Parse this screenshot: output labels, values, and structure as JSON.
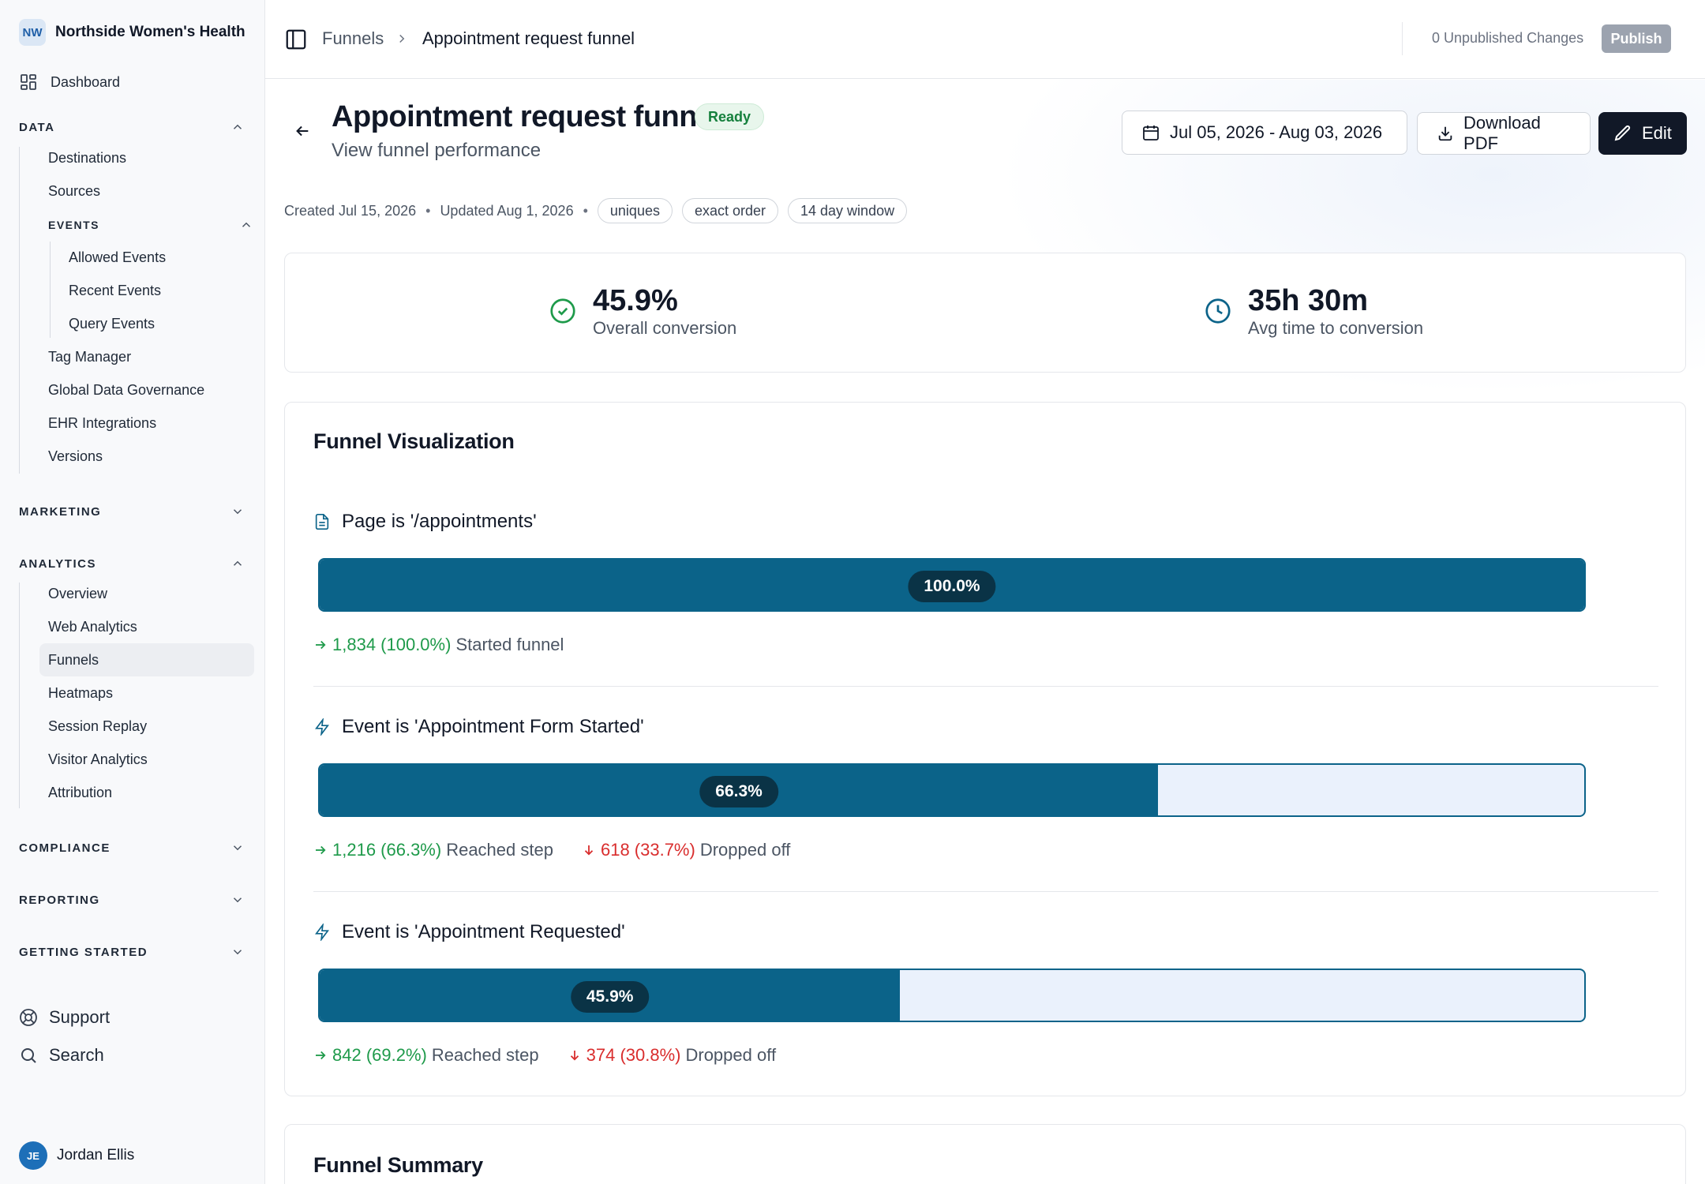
{
  "org": {
    "initials": "NW",
    "name": "Northside Women's Health"
  },
  "sidebar": {
    "dashboard": "Dashboard",
    "data": {
      "heading": "DATA",
      "items": [
        "Destinations",
        "Sources"
      ],
      "events": {
        "heading": "EVENTS",
        "items": [
          "Allowed Events",
          "Recent Events",
          "Query Events"
        ]
      },
      "more_items": [
        "Tag Manager",
        "Global Data Governance",
        "EHR Integrations",
        "Versions"
      ]
    },
    "marketing": "MARKETING",
    "analytics": {
      "heading": "ANALYTICS",
      "items": [
        "Overview",
        "Web Analytics",
        "Funnels",
        "Heatmaps",
        "Session Replay",
        "Visitor Analytics",
        "Attribution"
      ]
    },
    "compliance": "COMPLIANCE",
    "reporting": "REPORTING",
    "getting_started": "GETTING STARTED",
    "support": "Support",
    "search": "Search",
    "user": {
      "initials": "JE",
      "name": "Jordan Ellis"
    }
  },
  "topbar": {
    "breadcrumb": [
      "Funnels",
      "Appointment request funnel"
    ],
    "unpublished": "0 Unpublished Changes",
    "publish": "Publish"
  },
  "header": {
    "title": "Appointment request funnel",
    "status": "Ready",
    "subtitle": "View funnel performance",
    "date_range": "Jul 05, 2026 - Aug 03, 2026",
    "download": "Download PDF",
    "edit": "Edit"
  },
  "meta": {
    "created": "Created Jul 15, 2026",
    "updated": "Updated Aug 1, 2026",
    "tags": [
      "uniques",
      "exact order",
      "14 day window"
    ]
  },
  "kpis": {
    "conversion": {
      "value": "45.9%",
      "label": "Overall conversion"
    },
    "time": {
      "value": "35h 30m",
      "label": "Avg time to conversion"
    }
  },
  "funnel": {
    "title": "Funnel Visualization",
    "steps": [
      {
        "name": "Page is '/appointments'",
        "percent_label": "100.0%",
        "fraction": 1.0,
        "reached": "1,834 (100.0%)",
        "reached_label": "Started funnel"
      },
      {
        "name": "Event is 'Appointment Form Started'",
        "percent_label": "66.3%",
        "fraction": 0.663,
        "reached": "1,216 (66.3%)",
        "reached_label": "Reached step",
        "dropped": "618 (33.7%)",
        "dropped_label": "Dropped off"
      },
      {
        "name": "Event is 'Appointment Requested'",
        "percent_label": "45.9%",
        "fraction": 0.459,
        "reached": "842 (69.2%)",
        "reached_label": "Reached step",
        "dropped": "374 (30.8%)",
        "dropped_label": "Dropped off"
      }
    ]
  },
  "summary": {
    "title": "Funnel Summary"
  },
  "colors": {
    "bar": "#0b6389",
    "bar_bg": "#eaf1fc",
    "reached": "#1e9a4a",
    "dropped": "#d92d2d"
  }
}
